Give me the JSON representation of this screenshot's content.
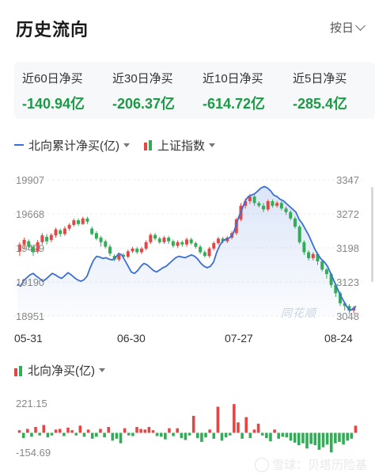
{
  "header": {
    "title": "历史流向",
    "period_label": "按日"
  },
  "stats": [
    {
      "label": "近60日净买",
      "value": "-140.94亿"
    },
    {
      "label": "近30日净买",
      "value": "-206.37亿"
    },
    {
      "label": "近10日净买",
      "value": "-614.72亿"
    },
    {
      "label": "近5日净买",
      "value": "-285.4亿"
    }
  ],
  "legend": {
    "line_label": "北向累计净买(亿)",
    "candle_label": "上证指数"
  },
  "colors": {
    "up": "#e64545",
    "down": "#2fae55",
    "line": "#3a6fd8",
    "value_green": "#1a9b46"
  },
  "chart_data": [
    {
      "type": "line",
      "title": "",
      "series": [
        {
          "name": "北向累计净买(亿)"
        }
      ],
      "left_axis": {
        "ticks": [
          "19907",
          "19668",
          "19429",
          "19190",
          "18951"
        ],
        "range": [
          18951,
          19907
        ]
      },
      "right_axis": {
        "ticks": [
          "3347",
          "3272",
          "3198",
          "3123",
          "3048"
        ],
        "range": [
          3048,
          3347
        ]
      },
      "x_ticks": [
        "05-31",
        "06-30",
        "07-27",
        "08-24"
      ],
      "line_values": [
        19175,
        19160,
        19200,
        19220,
        19240,
        19250,
        19230,
        19215,
        19195,
        19210,
        19230,
        19250,
        19240,
        19225,
        19215,
        19235,
        19255,
        19240,
        19220,
        19205,
        19195,
        19205,
        19230,
        19290,
        19340,
        19370,
        19365,
        19355,
        19360,
        19350,
        19345,
        19360,
        19390,
        19380,
        19340,
        19300,
        19260,
        19250,
        19270,
        19300,
        19320,
        19310,
        19290,
        19270,
        19260,
        19275,
        19290,
        19300,
        19320,
        19340,
        19360,
        19370,
        19365,
        19360,
        19370,
        19380,
        19370,
        19350,
        19320,
        19300,
        19290,
        19300,
        19330,
        19400,
        19450,
        19480,
        19490,
        19500,
        19520,
        19580,
        19650,
        19700,
        19760,
        19790,
        19800,
        19810,
        19830,
        19850,
        19860,
        19850,
        19830,
        19800,
        19790,
        19770,
        19760,
        19740,
        19720,
        19700,
        19680,
        19630,
        19600,
        19560,
        19520,
        19470,
        19420,
        19380,
        19350,
        19330,
        19300,
        19250,
        19200,
        19150,
        19100,
        19060,
        19020,
        18990,
        19000,
        19020
      ],
      "candles": [
        [
          3190,
          3205,
          3180,
          3210
        ],
        [
          3205,
          3215,
          3195,
          3220
        ],
        [
          3212,
          3200,
          3195,
          3216
        ],
        [
          3200,
          3188,
          3180,
          3205
        ],
        [
          3190,
          3210,
          3185,
          3215
        ],
        [
          3210,
          3225,
          3205,
          3230
        ],
        [
          3222,
          3212,
          3205,
          3228
        ],
        [
          3215,
          3226,
          3210,
          3230
        ],
        [
          3225,
          3238,
          3220,
          3242
        ],
        [
          3236,
          3228,
          3222,
          3240
        ],
        [
          3228,
          3240,
          3224,
          3245
        ],
        [
          3240,
          3248,
          3235,
          3252
        ],
        [
          3248,
          3258,
          3244,
          3262
        ],
        [
          3258,
          3250,
          3246,
          3262
        ],
        [
          3250,
          3262,
          3248,
          3266
        ],
        [
          3262,
          3255,
          3250,
          3266
        ],
        [
          3240,
          3228,
          3225,
          3244
        ],
        [
          3230,
          3218,
          3214,
          3234
        ],
        [
          3220,
          3210,
          3200,
          3224
        ],
        [
          3212,
          3200,
          3196,
          3216
        ],
        [
          3200,
          3185,
          3180,
          3205
        ],
        [
          3180,
          3172,
          3168,
          3184
        ],
        [
          3172,
          3182,
          3168,
          3186
        ],
        [
          3182,
          3178,
          3174,
          3186
        ],
        [
          3178,
          3190,
          3174,
          3194
        ],
        [
          3190,
          3196,
          3186,
          3200
        ],
        [
          3196,
          3188,
          3184,
          3200
        ],
        [
          3188,
          3196,
          3184,
          3200
        ],
        [
          3196,
          3210,
          3192,
          3214
        ],
        [
          3210,
          3226,
          3206,
          3230
        ],
        [
          3226,
          3218,
          3214,
          3230
        ],
        [
          3218,
          3210,
          3206,
          3222
        ],
        [
          3210,
          3220,
          3206,
          3224
        ],
        [
          3220,
          3212,
          3206,
          3224
        ],
        [
          3212,
          3202,
          3198,
          3216
        ],
        [
          3202,
          3210,
          3198,
          3214
        ],
        [
          3210,
          3205,
          3200,
          3214
        ],
        [
          3205,
          3216,
          3200,
          3220
        ],
        [
          3216,
          3208,
          3204,
          3220
        ],
        [
          3208,
          3200,
          3196,
          3212
        ],
        [
          3200,
          3188,
          3184,
          3204
        ],
        [
          3188,
          3180,
          3176,
          3192
        ],
        [
          3180,
          3196,
          3176,
          3200
        ],
        [
          3196,
          3208,
          3192,
          3212
        ],
        [
          3208,
          3218,
          3204,
          3222
        ],
        [
          3218,
          3212,
          3208,
          3222
        ],
        [
          3212,
          3220,
          3208,
          3224
        ],
        [
          3220,
          3230,
          3216,
          3234
        ],
        [
          3230,
          3260,
          3226,
          3264
        ],
        [
          3260,
          3290,
          3256,
          3296
        ],
        [
          3290,
          3300,
          3284,
          3306
        ],
        [
          3300,
          3310,
          3294,
          3316
        ],
        [
          3310,
          3296,
          3290,
          3314
        ],
        [
          3296,
          3290,
          3286,
          3300
        ],
        [
          3290,
          3282,
          3276,
          3296
        ],
        [
          3282,
          3300,
          3278,
          3304
        ],
        [
          3300,
          3290,
          3286,
          3304
        ],
        [
          3290,
          3296,
          3286,
          3300
        ],
        [
          3296,
          3284,
          3280,
          3300
        ],
        [
          3284,
          3276,
          3270,
          3288
        ],
        [
          3276,
          3262,
          3258,
          3280
        ],
        [
          3262,
          3244,
          3240,
          3266
        ],
        [
          3244,
          3210,
          3206,
          3248
        ],
        [
          3210,
          3188,
          3182,
          3214
        ],
        [
          3188,
          3175,
          3170,
          3192
        ],
        [
          3175,
          3184,
          3170,
          3188
        ],
        [
          3184,
          3168,
          3160,
          3188
        ],
        [
          3168,
          3150,
          3146,
          3172
        ],
        [
          3150,
          3140,
          3130,
          3154
        ],
        [
          3140,
          3116,
          3110,
          3144
        ],
        [
          3116,
          3098,
          3090,
          3120
        ],
        [
          3098,
          3076,
          3070,
          3102
        ],
        [
          3076,
          3070,
          3060,
          3080
        ],
        [
          3070,
          3060,
          3052,
          3074
        ],
        [
          3060,
          3066,
          3054,
          3070
        ]
      ]
    },
    {
      "type": "bar",
      "title": "",
      "series": [
        {
          "name": "北向净买(亿)"
        }
      ],
      "y_ticks": [
        "221.15",
        "-154.69"
      ],
      "ylim": [
        -154.69,
        221.15
      ],
      "values": [
        20,
        -40,
        30,
        -30,
        45,
        -20,
        60,
        -35,
        -20,
        25,
        30,
        -25,
        40,
        20,
        -20,
        55,
        -30,
        25,
        -45,
        -30,
        30,
        -35,
        45,
        -60,
        -45,
        -80,
        35,
        -20,
        -25,
        45,
        30,
        25,
        45,
        20,
        -25,
        -30,
        -50,
        35,
        -25,
        35,
        -40,
        -55,
        -20,
        130,
        -40,
        -70,
        -35,
        25,
        -45,
        200,
        -60,
        -35,
        -20,
        220,
        80,
        -45,
        120,
        -40,
        25,
        70,
        -20,
        -40,
        -65,
        25,
        -45,
        -30,
        -35,
        -60,
        -75,
        -95,
        -80,
        -120,
        -85,
        -95,
        -130,
        -110,
        -90,
        -150,
        -80,
        -70,
        -90,
        -60,
        -45,
        55
      ]
    }
  ],
  "watermarks": {
    "main": "同花顺",
    "bottom": "雪球：贝塔历险基"
  }
}
